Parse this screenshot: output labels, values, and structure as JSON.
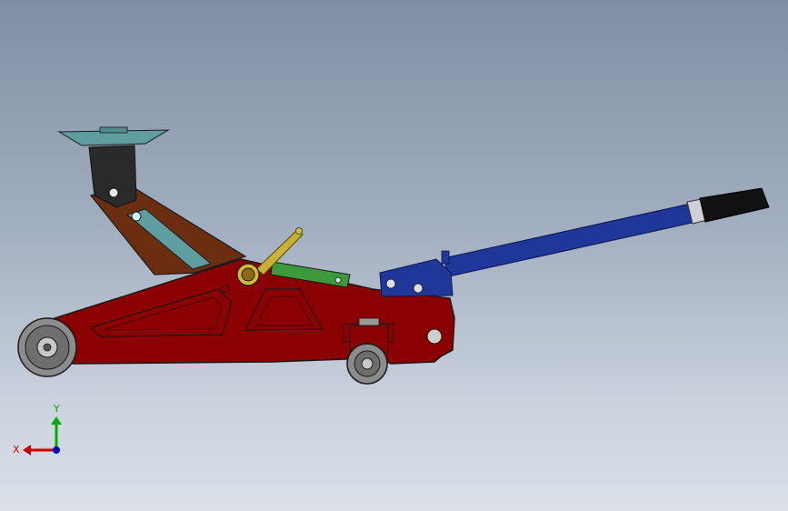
{
  "view": {
    "background_top": "#7f8fa4",
    "background_bottom": "#dbe0e8"
  },
  "model": {
    "frame_color": "#8b0000",
    "frame_outline": "#1a1a1a",
    "arm_color": "#6b2e10",
    "link_color": "#5f9ea0",
    "handle_color": "#1e3799",
    "grip_color": "#111111",
    "saddle_color": "#5f9ea0",
    "lever_color": "#c9b036",
    "panel_color": "#3c9a3c",
    "wheel_color": "#8c8c8c"
  },
  "triad": {
    "x_label": "X",
    "y_label": "Y",
    "x_color": "#cc0000",
    "y_color": "#00aa00",
    "z_color": "#0000cc"
  }
}
